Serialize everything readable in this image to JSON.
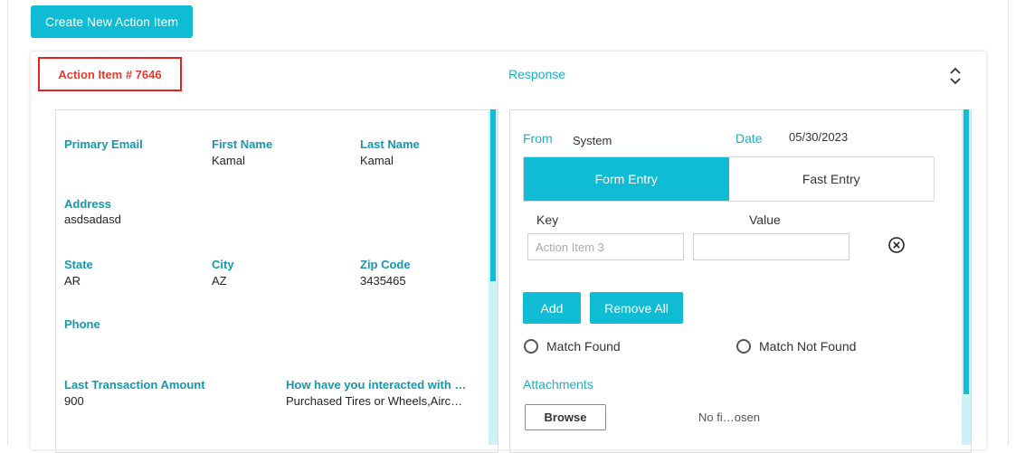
{
  "toolbar": {
    "create_label": "Create New Action Item"
  },
  "card": {
    "title": "Action Item # 7646",
    "response_title": "Response"
  },
  "customer": {
    "primary_email": {
      "label": "Primary Email",
      "value": ""
    },
    "first_name": {
      "label": "First Name",
      "value": "Kamal"
    },
    "last_name": {
      "label": "Last Name",
      "value": "Kamal"
    },
    "address": {
      "label": "Address",
      "value": "asdsadasd"
    },
    "state": {
      "label": "State",
      "value": "AR"
    },
    "city": {
      "label": "City",
      "value": "AZ"
    },
    "zip": {
      "label": "Zip Code",
      "value": "3435465"
    },
    "phone": {
      "label": "Phone",
      "value": ""
    },
    "last_txn": {
      "label": "Last Transaction Amount",
      "value": "900"
    },
    "interaction": {
      "label": "How have you interacted with …",
      "value": "Purchased Tires or Wheels,Airc…"
    }
  },
  "response": {
    "from_label": "From",
    "from_value": "System",
    "date_label": "Date",
    "date_value": "05/30/2023",
    "tabs": [
      {
        "label": "Form Entry",
        "active": true
      },
      {
        "label": "Fast Entry",
        "active": false
      }
    ],
    "key_header": "Key",
    "value_header": "Value",
    "key_placeholder": "Action Item 3",
    "value_input": "",
    "add_label": "Add",
    "remove_all_label": "Remove All",
    "match_found_label": "Match Found",
    "match_not_found_label": "Match Not Found",
    "attachments_label": "Attachments",
    "browse_label": "Browse",
    "no_file_text": "No fi…osen"
  },
  "colors": {
    "accent": "#10bcd4",
    "label_teal": "#1597ad",
    "title_red": "#e53a2f",
    "highlight_border": "#e02424"
  },
  "icons": {
    "sort": "sort-toggle-icon",
    "clear": "close-circle-icon"
  }
}
